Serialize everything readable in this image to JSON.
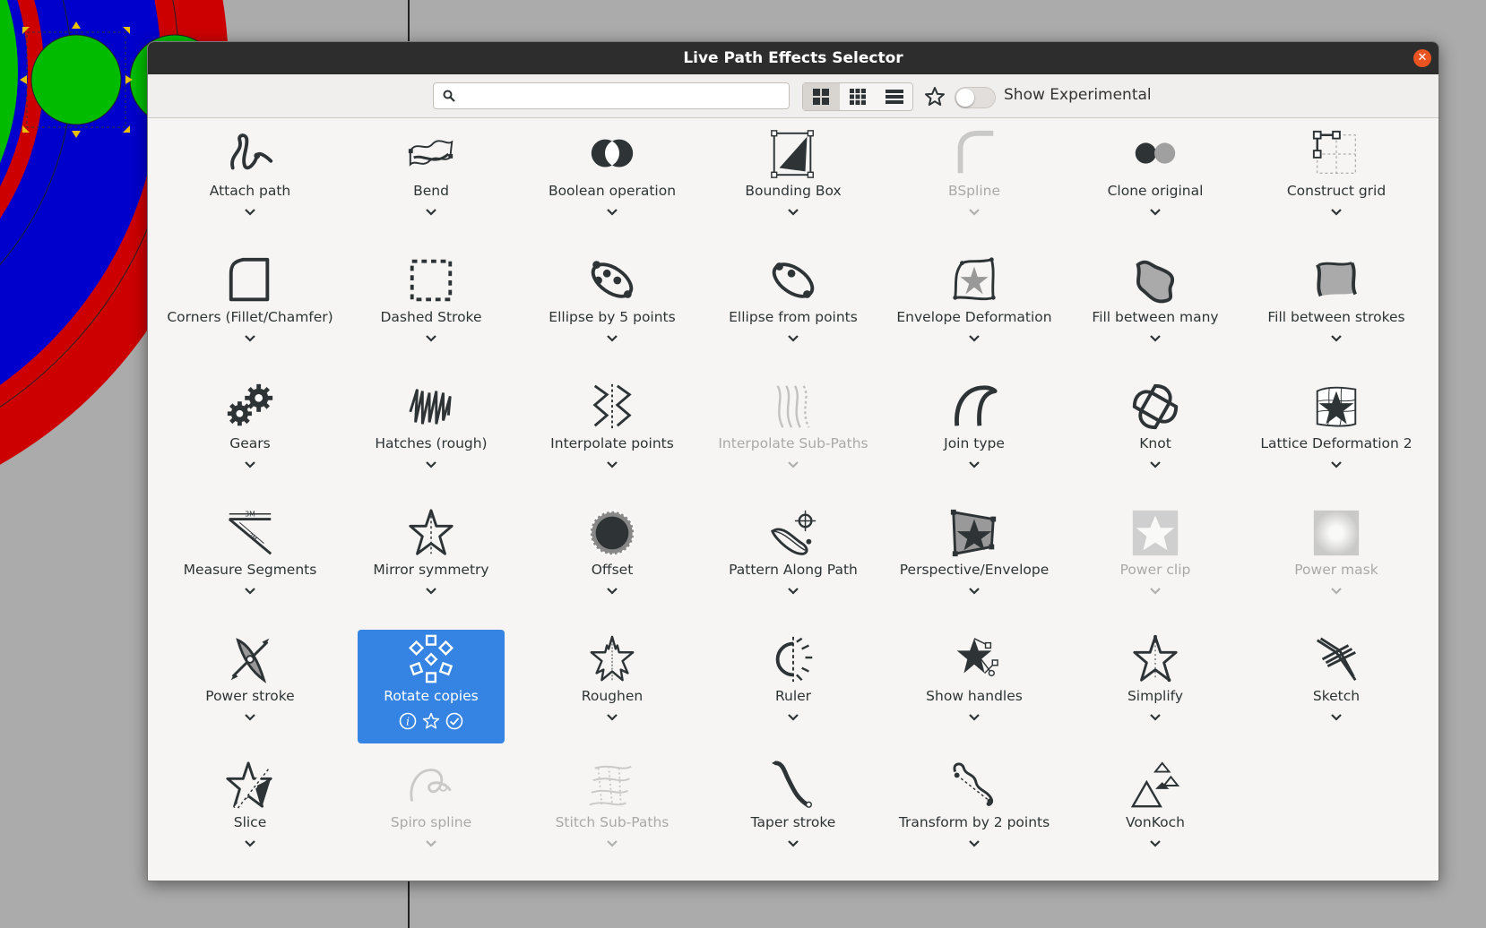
{
  "dialog": {
    "title": "Live Path Effects Selector",
    "close_icon": "close-icon"
  },
  "toolbar": {
    "search_value": "",
    "search_icon": "search-icon",
    "view_modes": [
      "large-grid-icon",
      "small-grid-icon",
      "list-icon"
    ],
    "active_view_mode": 0,
    "favorites_icon": "star-icon",
    "show_experimental_label": "Show Experimental",
    "show_experimental_on": false
  },
  "selected_effect_actions": [
    "info-icon",
    "star-icon",
    "check-icon"
  ],
  "effects": [
    {
      "label": "Attach path",
      "icon": "attach-path-icon",
      "enabled": true
    },
    {
      "label": "Bend",
      "icon": "bend-icon",
      "enabled": true
    },
    {
      "label": "Boolean operation",
      "icon": "boolean-operation-icon",
      "enabled": true
    },
    {
      "label": "Bounding Box",
      "icon": "bounding-box-icon",
      "enabled": true
    },
    {
      "label": "BSpline",
      "icon": "bspline-icon",
      "enabled": false
    },
    {
      "label": "Clone original",
      "icon": "clone-original-icon",
      "enabled": true
    },
    {
      "label": "Construct grid",
      "icon": "construct-grid-icon",
      "enabled": true
    },
    {
      "label": "Corners (Fillet/Chamfer)",
      "icon": "corners-icon",
      "enabled": true
    },
    {
      "label": "Dashed Stroke",
      "icon": "dashed-stroke-icon",
      "enabled": true
    },
    {
      "label": "Ellipse by 5 points",
      "icon": "ellipse-5-points-icon",
      "enabled": true
    },
    {
      "label": "Ellipse from points",
      "icon": "ellipse-from-points-icon",
      "enabled": true
    },
    {
      "label": "Envelope Deformation",
      "icon": "envelope-deformation-icon",
      "enabled": true
    },
    {
      "label": "Fill between many",
      "icon": "fill-between-many-icon",
      "enabled": true
    },
    {
      "label": "Fill between strokes",
      "icon": "fill-between-strokes-icon",
      "enabled": true
    },
    {
      "label": "Gears",
      "icon": "gears-icon",
      "enabled": true
    },
    {
      "label": "Hatches (rough)",
      "icon": "hatches-icon",
      "enabled": true
    },
    {
      "label": "Interpolate points",
      "icon": "interpolate-points-icon",
      "enabled": true
    },
    {
      "label": "Interpolate Sub-Paths",
      "icon": "interpolate-subpaths-icon",
      "enabled": false
    },
    {
      "label": "Join type",
      "icon": "join-type-icon",
      "enabled": true
    },
    {
      "label": "Knot",
      "icon": "knot-icon",
      "enabled": true
    },
    {
      "label": "Lattice Deformation 2",
      "icon": "lattice-deformation-icon",
      "enabled": true
    },
    {
      "label": "Measure Segments",
      "icon": "measure-segments-icon",
      "enabled": true
    },
    {
      "label": "Mirror symmetry",
      "icon": "mirror-symmetry-icon",
      "enabled": true
    },
    {
      "label": "Offset",
      "icon": "offset-icon",
      "enabled": true
    },
    {
      "label": "Pattern Along Path",
      "icon": "pattern-along-path-icon",
      "enabled": true
    },
    {
      "label": "Perspective/Envelope",
      "icon": "perspective-envelope-icon",
      "enabled": true
    },
    {
      "label": "Power clip",
      "icon": "power-clip-icon",
      "enabled": false
    },
    {
      "label": "Power mask",
      "icon": "power-mask-icon",
      "enabled": false
    },
    {
      "label": "Power stroke",
      "icon": "power-stroke-icon",
      "enabled": true
    },
    {
      "label": "Rotate copies",
      "icon": "rotate-copies-icon",
      "enabled": true,
      "selected": true
    },
    {
      "label": "Roughen",
      "icon": "roughen-icon",
      "enabled": true
    },
    {
      "label": "Ruler",
      "icon": "ruler-icon",
      "enabled": true
    },
    {
      "label": "Show handles",
      "icon": "show-handles-icon",
      "enabled": true
    },
    {
      "label": "Simplify",
      "icon": "simplify-icon",
      "enabled": true
    },
    {
      "label": "Sketch",
      "icon": "sketch-icon",
      "enabled": true
    },
    {
      "label": "Slice",
      "icon": "slice-icon",
      "enabled": true
    },
    {
      "label": "Spiro spline",
      "icon": "spiro-spline-icon",
      "enabled": false
    },
    {
      "label": "Stitch Sub-Paths",
      "icon": "stitch-subpaths-icon",
      "enabled": false
    },
    {
      "label": "Taper stroke",
      "icon": "taper-stroke-icon",
      "enabled": true
    },
    {
      "label": "Transform by 2 points",
      "icon": "transform-2-points-icon",
      "enabled": true
    },
    {
      "label": "VonKoch",
      "icon": "vonkoch-icon",
      "enabled": true
    }
  ],
  "canvas_colors": {
    "background": "#ababab",
    "red": "#cc0000",
    "blue": "#0000cc",
    "green": "#00bb00"
  }
}
